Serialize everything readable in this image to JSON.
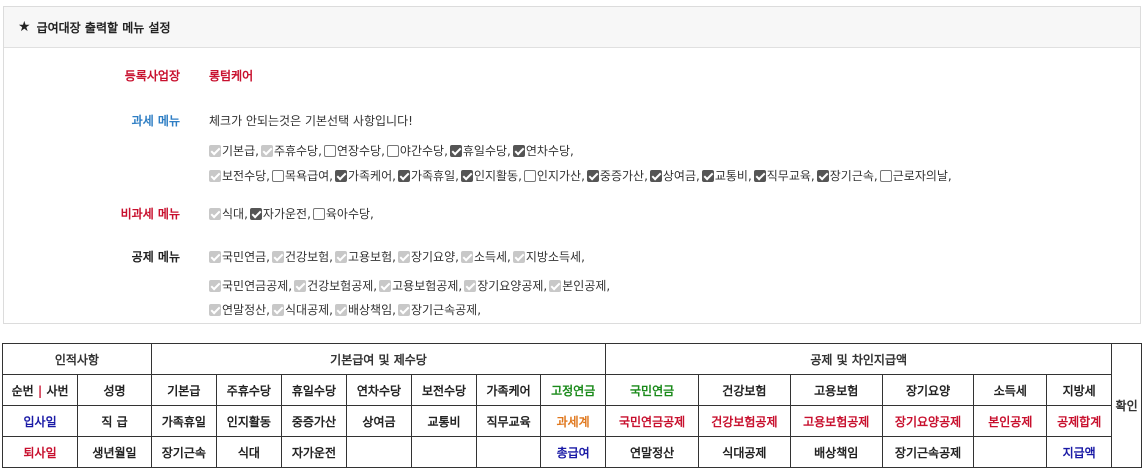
{
  "panel": {
    "title": "급여대장 출력할 메뉴 설정"
  },
  "company": {
    "label": "등록사업장",
    "value": "롱텀케어"
  },
  "taxable": {
    "label": "과세 메뉴",
    "note": "체크가 안되는것은 기본선택 사항입니다!",
    "lines": [
      [
        {
          "text": "기본급,",
          "state": "dis"
        },
        {
          "text": "주휴수당,",
          "state": "dis"
        },
        {
          "text": "연장수당,",
          "state": "off"
        },
        {
          "text": "야간수당,",
          "state": "off"
        },
        {
          "text": "휴일수당,",
          "state": "on"
        },
        {
          "text": "연차수당,",
          "state": "on"
        }
      ],
      [
        {
          "text": "보전수당,",
          "state": "dis"
        },
        {
          "text": "목욕급여,",
          "state": "off"
        },
        {
          "text": "가족케어,",
          "state": "on"
        },
        {
          "text": "가족휴일,",
          "state": "on"
        },
        {
          "text": "인지활동,",
          "state": "on"
        },
        {
          "text": "인지가산,",
          "state": "off"
        },
        {
          "text": "중증가산,",
          "state": "on"
        },
        {
          "text": "상여금,",
          "state": "on"
        },
        {
          "text": "교통비,",
          "state": "on"
        },
        {
          "text": "직무교육,",
          "state": "on"
        },
        {
          "text": "장기근속,",
          "state": "on"
        },
        {
          "text": "근로자의날,",
          "state": "off"
        }
      ]
    ]
  },
  "nontaxable": {
    "label": "비과세 메뉴",
    "lines": [
      [
        {
          "text": "식대,",
          "state": "dis"
        },
        {
          "text": "자가운전,",
          "state": "on"
        },
        {
          "text": "육아수당,",
          "state": "off"
        }
      ]
    ]
  },
  "deduction": {
    "label": "공제 메뉴",
    "lines": [
      [
        {
          "text": "국민연금,",
          "state": "dis"
        },
        {
          "text": "건강보험,",
          "state": "dis"
        },
        {
          "text": "고용보험,",
          "state": "dis"
        },
        {
          "text": "장기요양,",
          "state": "dis"
        },
        {
          "text": "소득세,",
          "state": "dis"
        },
        {
          "text": "지방소득세,",
          "state": "dis"
        }
      ],
      [
        {
          "text": "국민연금공제,",
          "state": "dis"
        },
        {
          "text": "건강보험공제,",
          "state": "dis"
        },
        {
          "text": "고용보험공제,",
          "state": "dis"
        },
        {
          "text": "장기요양공제,",
          "state": "dis"
        },
        {
          "text": "본인공제,",
          "state": "dis"
        }
      ],
      [
        {
          "text": "연말정산,",
          "state": "dis"
        },
        {
          "text": "식대공제,",
          "state": "dis"
        },
        {
          "text": "배상책임,",
          "state": "dis"
        },
        {
          "text": "장기근속공제,",
          "state": "dis"
        }
      ]
    ]
  },
  "grid": {
    "h_person": "인적사항",
    "h_basic": "기본급여 및 제수당",
    "h_deduct": "공제 및 차인지급액",
    "h_confirm": "확인",
    "r1": [
      "순번",
      "|",
      "사번",
      "성명",
      "기본급",
      "주휴수당",
      "휴일수당",
      "연차수당",
      "보전수당",
      "가족케어",
      "고정연금",
      "국민연금",
      "건강보험",
      "고용보험",
      "장기요양",
      "소득세",
      "지방세"
    ],
    "r2": [
      "입사일",
      "직 급",
      "가족휴일",
      "인지활동",
      "중증가산",
      "상여금",
      "교통비",
      "직무교육",
      "과세계",
      "국민연금공제",
      "건강보험공제",
      "고용보험공제",
      "장기요양공제",
      "본인공제",
      "공제합계"
    ],
    "r3": [
      "퇴사일",
      "생년월일",
      "장기근속",
      "식대",
      "자가운전",
      "",
      "",
      "",
      "총급여",
      "연말정산",
      "식대공제",
      "배상책임",
      "장기근속공제",
      "",
      "지급액"
    ]
  }
}
